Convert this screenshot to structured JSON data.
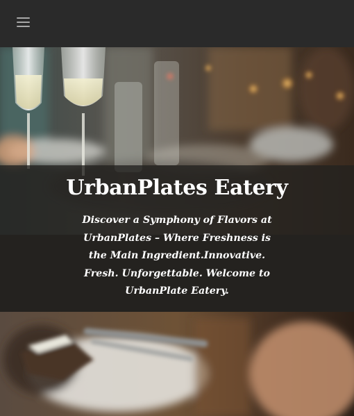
{
  "navbar": {
    "menu_icon": "hamburger-menu-icon"
  },
  "hero": {
    "title": "UrbanPlates Eatery",
    "tagline": "Discover a Symphony of Flavors at UrbanPlates – Where Freshness is the Main Ingredient.Innovative. Fresh. Unforgettable. Welcome to UrbanPlate Eatery."
  },
  "colors": {
    "navbar_bg": "#2a2a2a",
    "menu_icon": "#a8a8a8",
    "caption_overlay": "#23211f",
    "title_text": "#ffffff"
  }
}
